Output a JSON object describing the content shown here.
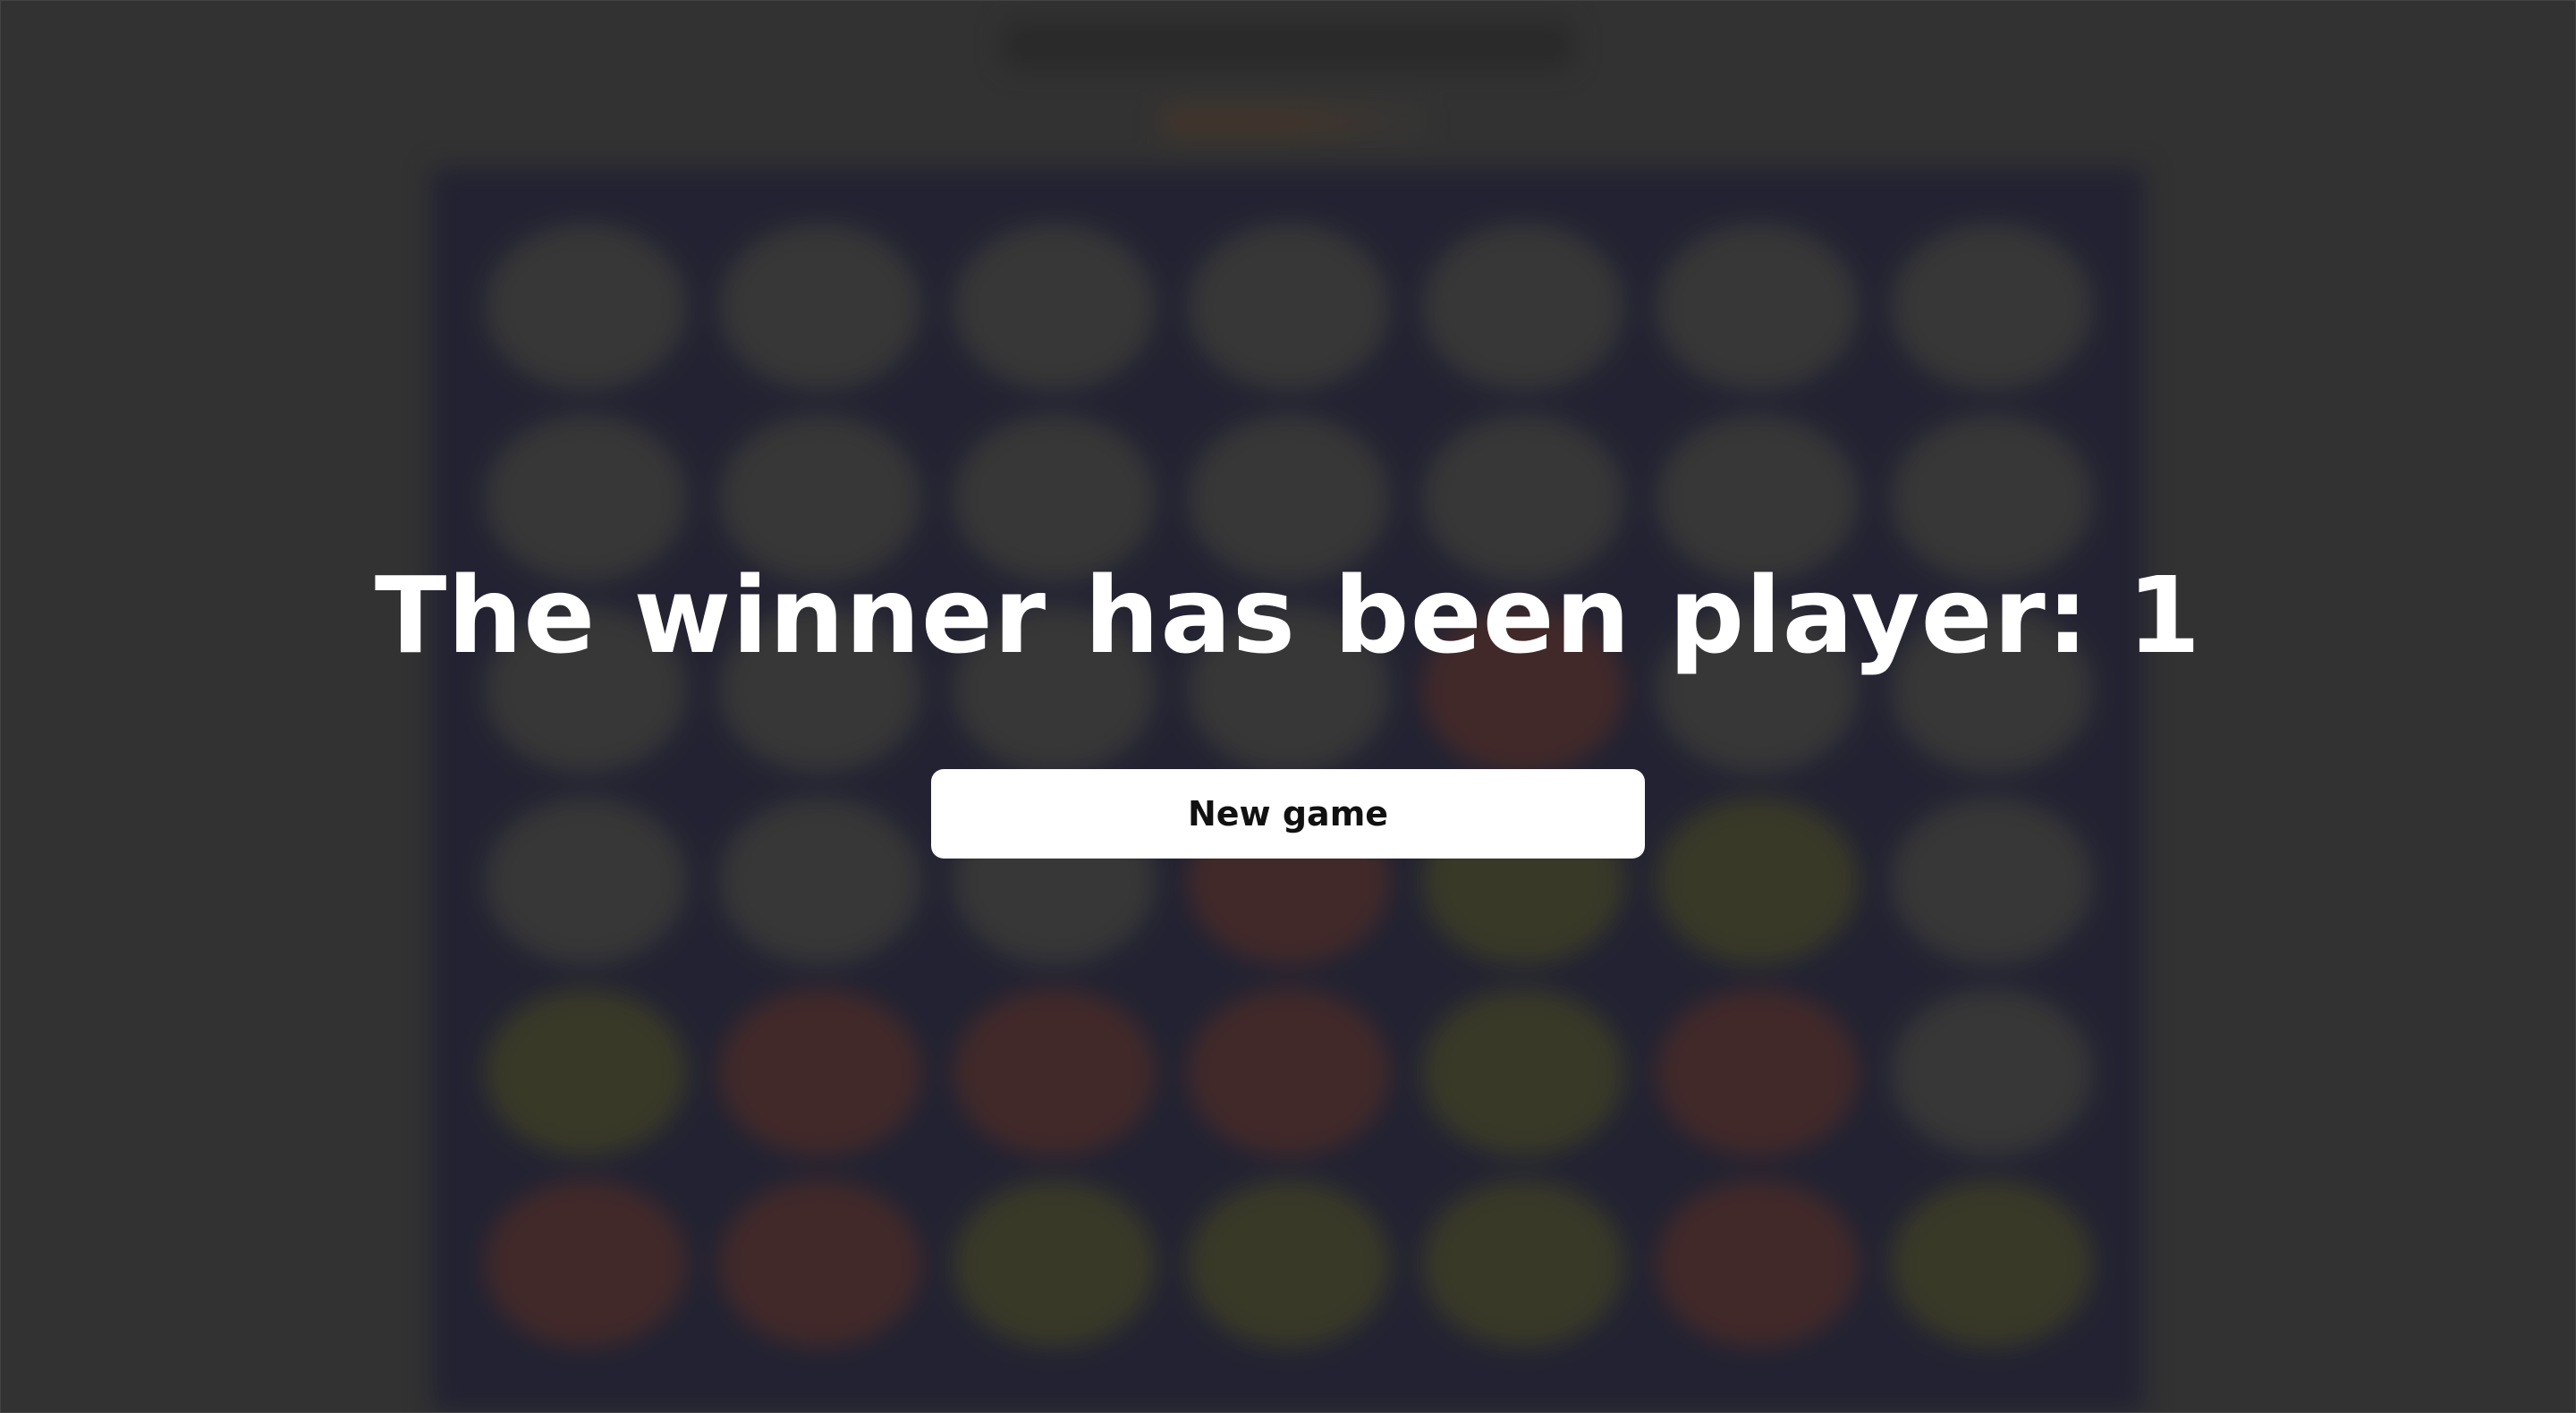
{
  "overlay": {
    "winner_text": "The winner has been player: 1",
    "new_game_label": "New game"
  },
  "board": {
    "rows": 6,
    "columns": 7,
    "colors": {
      "background": "#1c1c33",
      "empty": "#3a3a3a",
      "player_red": "#4a2626",
      "player_yellow": "#3d3d24"
    },
    "cells": [
      [
        "empty",
        "empty",
        "empty",
        "empty",
        "empty",
        "empty",
        "empty"
      ],
      [
        "empty",
        "empty",
        "empty",
        "empty",
        "empty",
        "empty",
        "empty"
      ],
      [
        "empty",
        "empty",
        "empty",
        "empty",
        "red",
        "empty",
        "empty"
      ],
      [
        "empty",
        "empty",
        "empty",
        "red",
        "yellow",
        "yellow",
        "empty"
      ],
      [
        "yellow",
        "red",
        "red",
        "red",
        "yellow",
        "red",
        "empty"
      ],
      [
        "red",
        "red",
        "yellow",
        "yellow",
        "yellow",
        "red",
        "yellow"
      ]
    ]
  }
}
